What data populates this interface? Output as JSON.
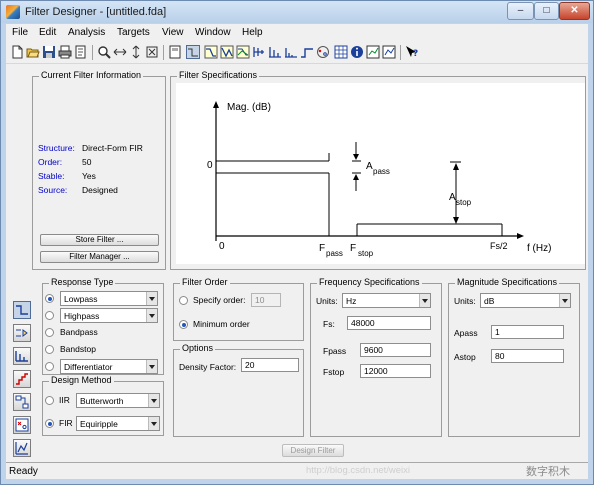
{
  "window": {
    "title": "Filter Designer - [untitled.fda]",
    "minimize": "–",
    "maximize": "□",
    "close": "✕"
  },
  "menu": [
    "File",
    "Edit",
    "Analysis",
    "Targets",
    "View",
    "Window",
    "Help"
  ],
  "current_filter_info": {
    "title": "Current Filter Information",
    "rows": [
      {
        "label": "Structure:",
        "value": "Direct-Form FIR"
      },
      {
        "label": "Order:",
        "value": "50"
      },
      {
        "label": "Stable:",
        "value": "Yes"
      },
      {
        "label": "Source:",
        "value": "Designed"
      }
    ],
    "store_button": "Store Filter ...",
    "manager_button": "Filter Manager ..."
  },
  "filter_specs": {
    "title": "Filter Specifications",
    "ylabel": "Mag. (dB)",
    "y_zero": "0",
    "x_zero": "0",
    "apass_main": "A",
    "apass_sub": "pass",
    "astop_main": "A",
    "astop_sub": "stop",
    "fpass_main": "F",
    "fpass_sub": "pass",
    "fstop_main": "F",
    "fstop_sub": "stop",
    "fs2": "Fs/2",
    "xlabel": "f (Hz)"
  },
  "response_type": {
    "title": "Response Type",
    "lowpass": "Lowpass",
    "highpass": "Highpass",
    "bandpass": "Bandpass",
    "bandstop": "Bandstop",
    "differentiator": "Differentiator",
    "selected": "lowpass"
  },
  "design_method": {
    "title": "Design Method",
    "iir_label": "IIR",
    "iir_value": "Butterworth",
    "fir_label": "FIR",
    "fir_value": "Equiripple",
    "selected": "fir"
  },
  "filter_order": {
    "title": "Filter Order",
    "specify_label": "Specify order:",
    "specify_value": "10",
    "minimum_label": "Minimum order",
    "selected": "minimum"
  },
  "options": {
    "title": "Options",
    "density_label": "Density Factor:",
    "density_value": "20"
  },
  "freq_specs": {
    "title": "Frequency Specifications",
    "units_label": "Units:",
    "units_value": "Hz",
    "fs_label": "Fs:",
    "fs_value": "48000",
    "fpass_label": "Fpass",
    "fpass_value": "9600",
    "fstop_label": "Fstop",
    "fstop_value": "12000"
  },
  "mag_specs": {
    "title": "Magnitude Specifications",
    "units_label": "Units:",
    "units_value": "dB",
    "apass_label": "Apass",
    "apass_value": "1",
    "astop_label": "Astop",
    "astop_value": "80"
  },
  "design_button": "Design Filter",
  "status": {
    "text": "Ready",
    "watermark": "http://blog.csdn.net/weixi",
    "brand": "数字积木"
  }
}
